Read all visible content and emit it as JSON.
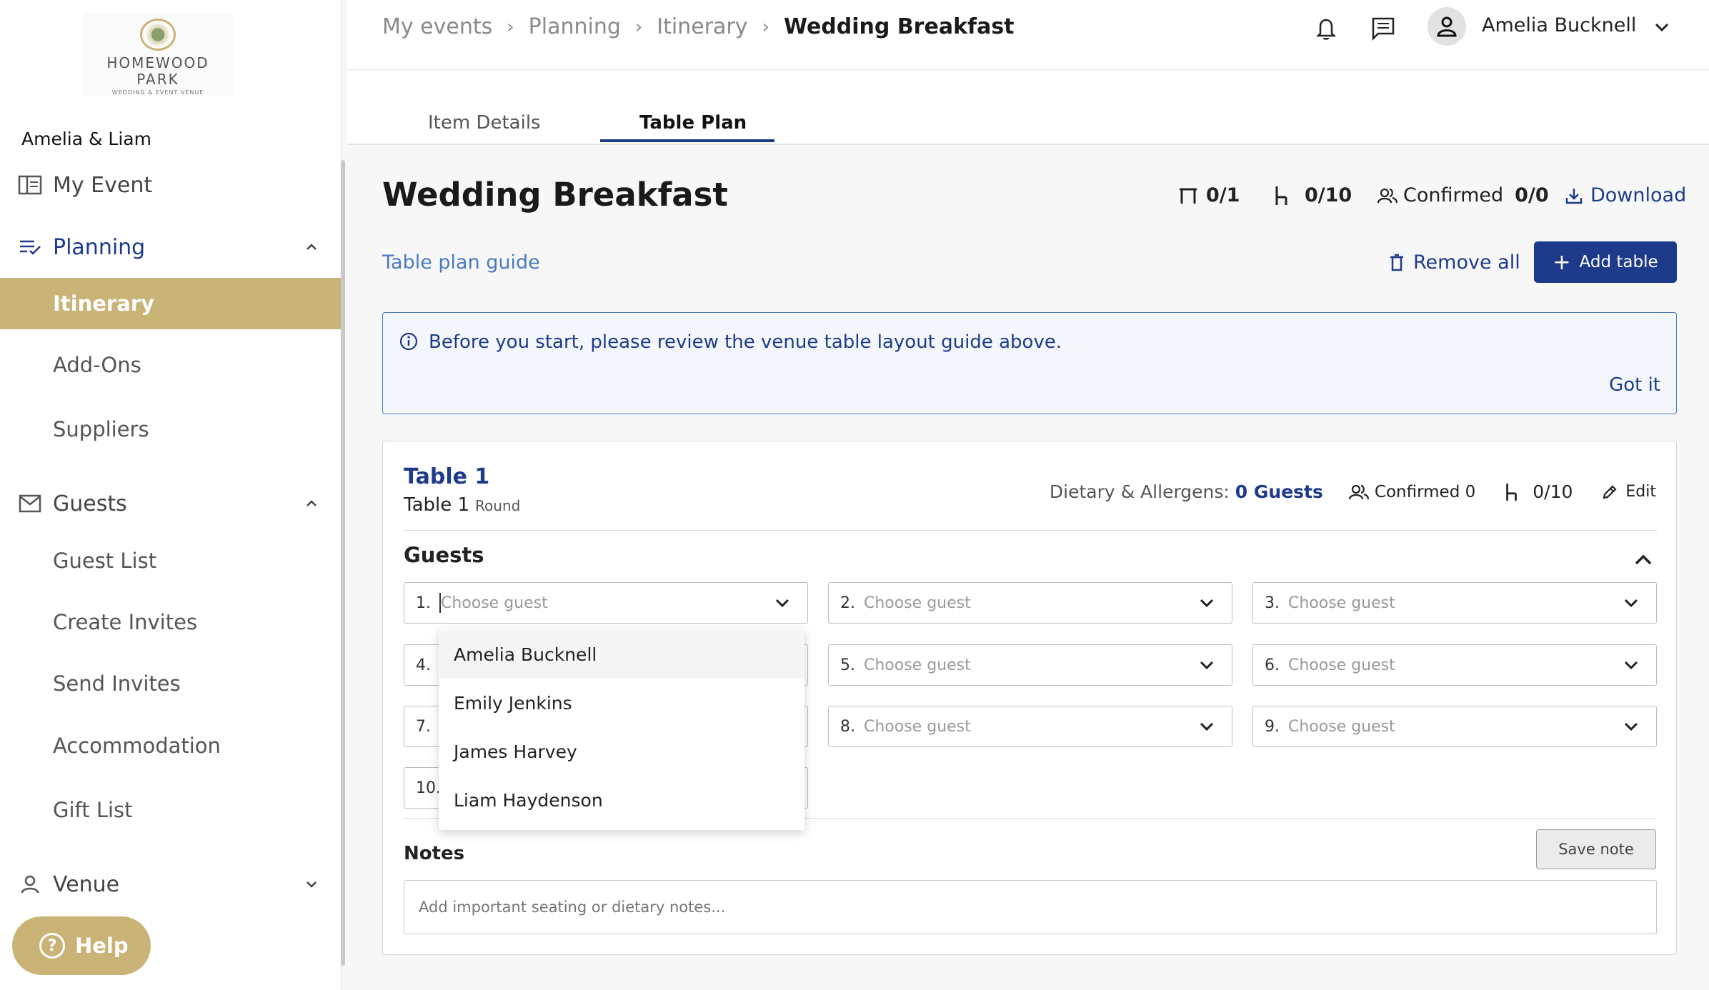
{
  "brand": {
    "name_line1": "HOMEWOOD",
    "name_line2": "PARK",
    "tagline": "WEDDING & EVENT VENUE",
    "accent": "#c9b377",
    "primary": "#1e3a8a"
  },
  "sidebar": {
    "couple": "Amelia & Liam",
    "my_event": "My Event",
    "planning": {
      "label": "Planning",
      "items": [
        "Itinerary",
        "Add-Ons",
        "Suppliers"
      ]
    },
    "guests": {
      "label": "Guests",
      "items": [
        "Guest List",
        "Create Invites",
        "Send Invites",
        "Accommodation",
        "Gift List"
      ]
    },
    "venue": "Venue",
    "help": "Help"
  },
  "header": {
    "breadcrumbs": [
      "My events",
      "Planning",
      "Itinerary"
    ],
    "current": "Wedding Breakfast",
    "user_name": "Amelia Bucknell"
  },
  "tabs": [
    "Item Details",
    "Table Plan"
  ],
  "main": {
    "title": "Wedding Breakfast",
    "tables_count": "0/1",
    "seats_count": "0/10",
    "confirmed_label": "Confirmed",
    "confirmed_count": "0/0",
    "download": "Download",
    "guide_link": "Table plan guide",
    "remove_all": "Remove all",
    "add_table": "Add table",
    "notice": "Before you start, please review the venue table layout guide above.",
    "got_it": "Got it"
  },
  "table": {
    "title": "Table 1",
    "name": "Table 1",
    "shape": "Round",
    "dietary_label": "Dietary & Allergens:",
    "dietary_value": "0 Guests",
    "confirmed": "Confirmed 0",
    "seats": "0/10",
    "edit": "Edit",
    "guests_heading": "Guests",
    "seat_numbers": [
      "1.",
      "2.",
      "3.",
      "4.",
      "5.",
      "6.",
      "7.",
      "8.",
      "9.",
      "10."
    ],
    "seat_placeholder": "Choose guest",
    "notes_heading": "Notes",
    "save_note": "Save note",
    "notes_placeholder": "Add important seating or dietary notes..."
  },
  "dropdown_options": [
    "Amelia Bucknell",
    "Emily Jenkins",
    "James Harvey",
    "Liam Haydenson"
  ]
}
